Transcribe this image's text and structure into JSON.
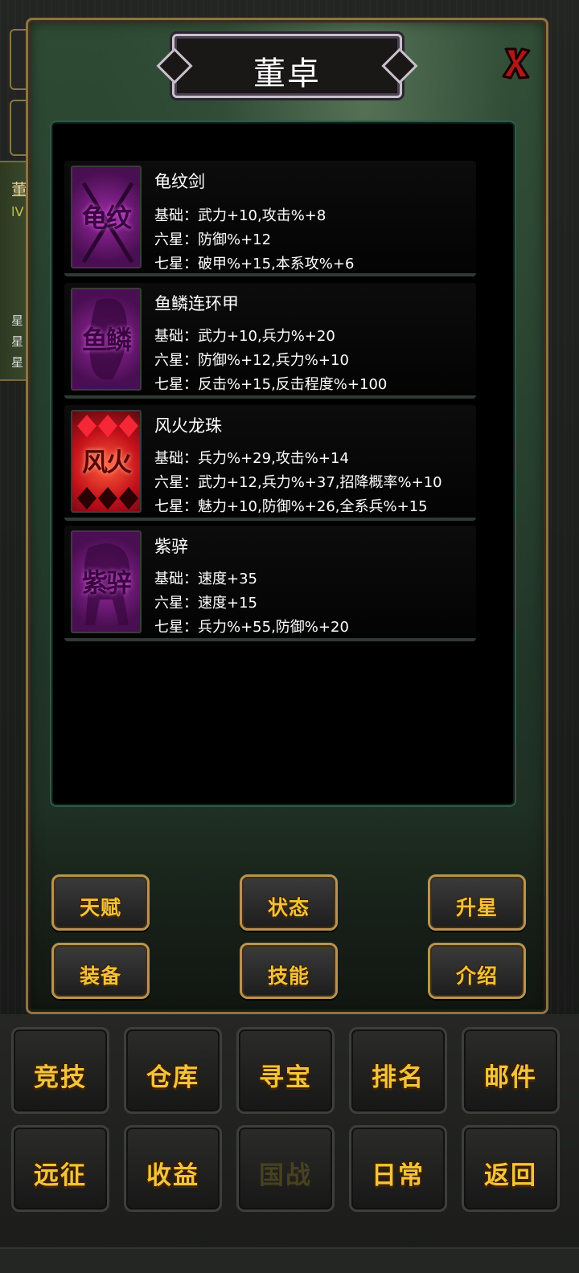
{
  "dialog": {
    "title": "董卓",
    "close_label": "X"
  },
  "left_peek": {
    "name_char": "董",
    "level_char": "lV",
    "rows": [
      "星",
      "星",
      "星"
    ]
  },
  "equipment": [
    {
      "name": "龟纹剑",
      "icon_label": "龟纹",
      "icon_style": "purple",
      "lines": [
        "基础：武力+10,攻击%+8",
        "六星：防御%+12",
        "七星：破甲%+15,本系攻%+6"
      ]
    },
    {
      "name": "鱼鳞连环甲",
      "icon_label": "鱼鳞",
      "icon_style": "purple",
      "lines": [
        "基础：武力+10,兵力%+20",
        "六星：防御%+12,兵力%+10",
        "七星：反击%+15,反击程度%+100"
      ]
    },
    {
      "name": "风火龙珠",
      "icon_label": "风火",
      "icon_style": "red",
      "lines": [
        "基础：兵力%+29,攻击%+14",
        "六星：武力+12,兵力%+37,招降概率%+10",
        "七星：魅力+10,防御%+26,全系兵%+15"
      ]
    },
    {
      "name": "紫骍",
      "icon_label": "紫骍",
      "icon_style": "purple",
      "lines": [
        "基础：速度+35",
        "六星：速度+15",
        "七星：兵力%+55,防御%+20"
      ]
    }
  ],
  "panel_buttons": [
    "天赋",
    "状态",
    "升星",
    "装备",
    "技能",
    "介绍"
  ],
  "nav_buttons": [
    "竞技",
    "仓库",
    "寻宝",
    "排名",
    "邮件",
    "远征",
    "收益",
    "国战",
    "日常",
    "返回"
  ],
  "colors": {
    "button_text": "#f0c23a",
    "panel_border": "#8c7444",
    "list_border": "#2d5a48"
  }
}
